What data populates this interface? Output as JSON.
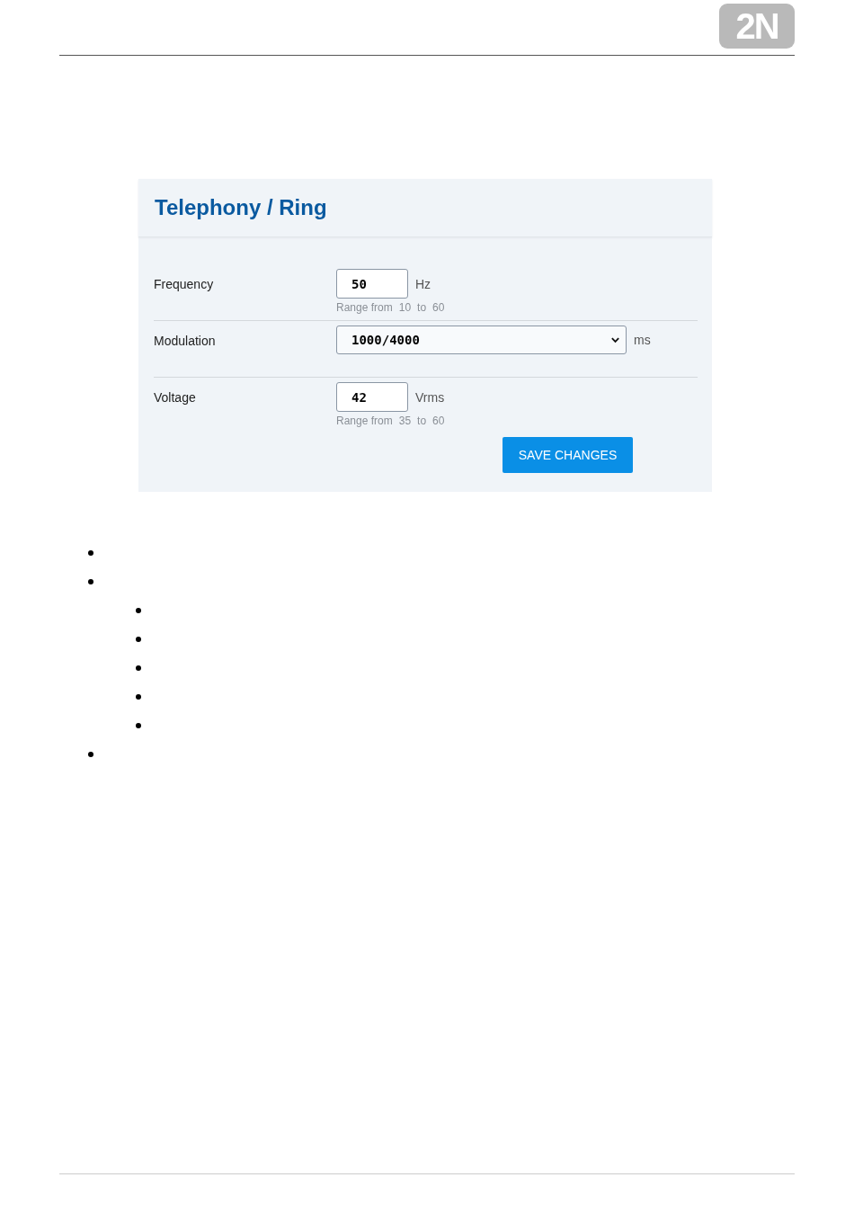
{
  "logo": {
    "text": "2N"
  },
  "panel": {
    "title": "Telephony / Ring",
    "fields": [
      {
        "kind": "number",
        "label": "Frequency",
        "value": "50",
        "unit": "Hz",
        "range": {
          "prefix": "Range from",
          "min": "10",
          "to": "to",
          "max": "60"
        }
      },
      {
        "kind": "select",
        "label": "Modulation",
        "value": "1000/4000",
        "unit": "ms"
      },
      {
        "kind": "number",
        "label": "Voltage",
        "value": "42",
        "unit": "Vrms",
        "range": {
          "prefix": "Range from",
          "min": "35",
          "to": "to",
          "max": "60"
        }
      }
    ],
    "save_button": "SAVE CHANGES"
  },
  "bullet_list": [
    {
      "kind": "bullet"
    },
    {
      "kind": "bullet",
      "children": [
        {
          "kind": "bullet"
        },
        {
          "kind": "bullet"
        },
        {
          "kind": "bullet"
        },
        {
          "kind": "bullet"
        },
        {
          "kind": "bullet"
        }
      ]
    },
    {
      "kind": "bullet"
    }
  ]
}
